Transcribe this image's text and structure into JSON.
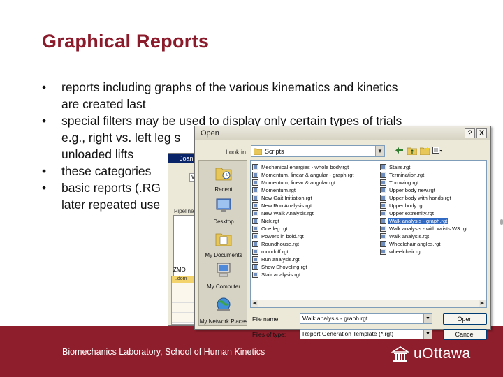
{
  "slide": {
    "title": "Graphical Reports",
    "bullets": [
      "reports including graphs of the various kinematics and kinetics are created last",
      "special filters may be used to display only certain types of trials, e.g., right vs. left leg s",
      "these categories",
      "basic reports (.RG later repeated use"
    ],
    "bullet_lines": {
      "b1": "reports including graphs of the various kinematics and kinetics",
      "b1b": "are created last",
      "b2": "special filters may be used to display only certain types of trials",
      "b2b": "e.g., right vs. left leg s",
      "b2c": "unloaded lifts",
      "b3": "these categories",
      "b4": "basic reports (.RG",
      "b4b": "later repeated use"
    },
    "footer": "Biomechanics Laboratory, School of Human Kinetics",
    "logo_text": "uOttawa",
    "brand_color": "#8f1e2c"
  },
  "background_window": {
    "title": "Joan",
    "tab": "Walk",
    "label": "Pipeline",
    "grid_title": "ZMO",
    "grid_head": "..dom"
  },
  "dialog": {
    "title": "Open",
    "help_label": "?",
    "close_label": "X",
    "look_in_label": "Look in:",
    "look_in_value": "Scripts",
    "places": [
      "Recent",
      "Desktop",
      "My Documents",
      "My Computer",
      "My Network Places"
    ],
    "files_col1": [
      "Mechanical energies - whole body.rgt",
      "Momentum, linear & angular - graph.rgt",
      "Momentum, linear & angular.rgt",
      "Momentum.rgt",
      "New Gait Initiation.rgt",
      "New Run Analysis.rgt",
      "New Walk Analysis.rgt",
      "Nick.rgt",
      "One leg.rgt",
      "Powers in bold.rgt",
      "Roundhouse.rgt",
      "roundoff.rgt",
      "Run analysis.rgt",
      "Show Shoveling.rgt",
      "Stair analysis.rgt"
    ],
    "files_col2": [
      "Stairs.rgt",
      "Termination.rgt",
      "Throwing.rgt",
      "Upper body new.rgt",
      "Upper body with hands.rgt",
      "Upper body.rgt",
      "Upper extremity.rgt",
      "Walk analysis - graph.rgt",
      "Walk analysis - with wrists.W3.rgt",
      "Walk analysis.rgt",
      "Wheelchair angles.rgt",
      "wheelchair.rgt"
    ],
    "selected_file": "Walk analysis - graph.rgt",
    "file_name_label": "File name:",
    "file_name_value": "Walk analysis - graph.rgt",
    "files_of_type_label": "Files of type:",
    "files_of_type_value": "Report Generation Template (*.rgt)",
    "open_button": "Open",
    "cancel_button": "Cancel"
  }
}
